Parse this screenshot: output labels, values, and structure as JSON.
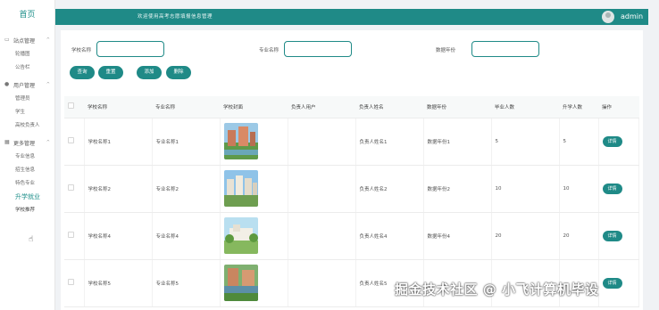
{
  "sidebar": {
    "brand": "首页",
    "groups": [
      {
        "label": "站点管理",
        "icon": "monitor-icon",
        "items": [
          "轮播图",
          "公告栏"
        ]
      },
      {
        "label": "用户管理",
        "icon": "user-icon",
        "items": [
          "管理员",
          "学生",
          "高校负责人"
        ]
      },
      {
        "label": "更多管理",
        "icon": "grid-icon",
        "items": [
          "专业信息",
          "招生信息",
          "特色专业",
          "升学就业",
          "学校推荐"
        ]
      }
    ],
    "active_item": "升学就业"
  },
  "header": {
    "title": "欢迎使用高考志愿填报信息管理",
    "user": "admin"
  },
  "search": {
    "fields": [
      {
        "label": "学校名称",
        "value": "",
        "placeholder": ""
      },
      {
        "label": "专业名称",
        "value": "",
        "placeholder": ""
      },
      {
        "label": "数据年份",
        "value": "",
        "placeholder": ""
      }
    ]
  },
  "actions": {
    "query": "查询",
    "reset": "重置",
    "add": "添加",
    "delete": "删除"
  },
  "table": {
    "columns": [
      "学校名称",
      "专业名称",
      "学校封面",
      "负责人用户",
      "负责人姓名",
      "数据年份",
      "毕业人数",
      "升学人数",
      "操作"
    ],
    "rows": [
      {
        "school": "学校名称1",
        "major": "专业名称1",
        "owner_user": "",
        "owner_name": "负责人姓名1",
        "year": "数据年份1",
        "grads": "5",
        "further": "5",
        "action": "详情"
      },
      {
        "school": "学校名称2",
        "major": "专业名称2",
        "owner_user": "",
        "owner_name": "负责人姓名2",
        "year": "数据年份2",
        "grads": "10",
        "further": "10",
        "action": "详情"
      },
      {
        "school": "学校名称4",
        "major": "专业名称4",
        "owner_user": "",
        "owner_name": "负责人姓名4",
        "year": "数据年份4",
        "grads": "20",
        "further": "20",
        "action": "详情"
      },
      {
        "school": "学校名称5",
        "major": "专业名称5",
        "owner_user": "",
        "owner_name": "负责人姓名5",
        "year": "",
        "grads": "",
        "further": "",
        "action": "详情"
      }
    ]
  },
  "watermark": "掘金技术社区 @ 小飞计算机毕设",
  "colors": {
    "accent": "#1f8a87",
    "background": "#f0f2f5"
  }
}
